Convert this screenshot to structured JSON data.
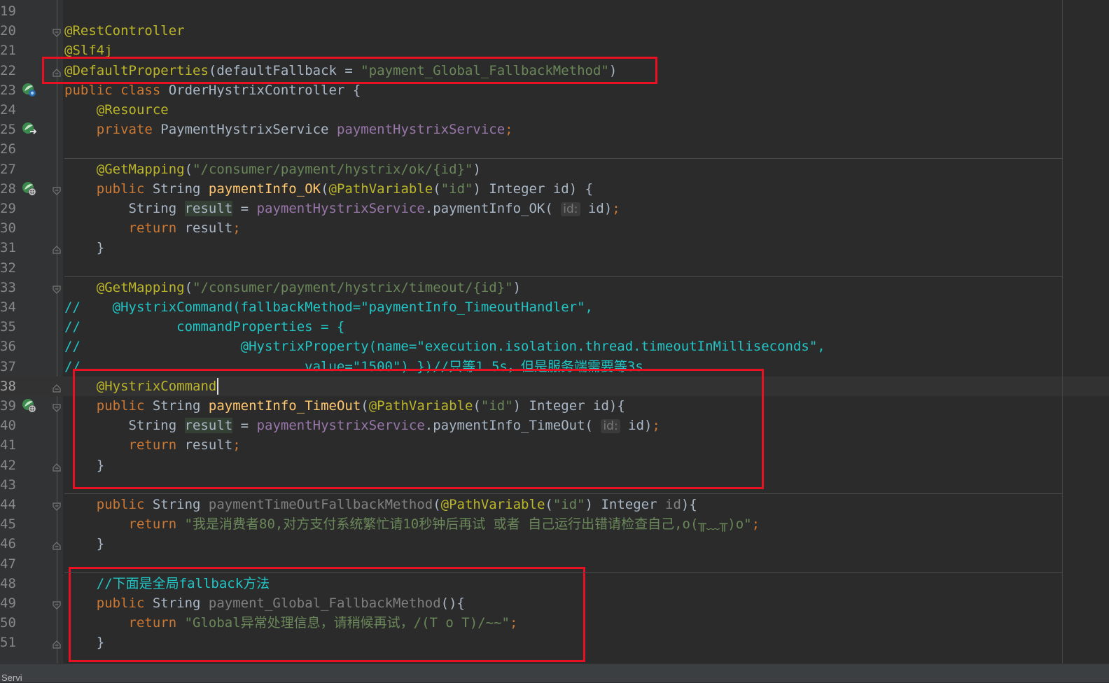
{
  "editor": {
    "language": "java",
    "current_line": 38,
    "lines": [
      {
        "n": "19",
        "segs": []
      },
      {
        "n": "20",
        "segs": [
          [
            "ann",
            "@RestController"
          ]
        ],
        "fold": "open"
      },
      {
        "n": "21",
        "segs": [
          [
            "ann",
            "@Slf4j"
          ]
        ]
      },
      {
        "n": "22",
        "segs": [
          [
            "ann",
            "@DefaultProperties"
          ],
          [
            "",
            "("
          ],
          [
            "",
            "defaultFallback = "
          ],
          [
            "str",
            "\"payment_Global_FallbackMethod\""
          ],
          [
            "",
            ")"
          ]
        ],
        "fold": "close"
      },
      {
        "n": "23",
        "segs": [
          [
            "kw",
            "public class "
          ],
          [
            "",
            "OrderHystrixController {"
          ]
        ],
        "marker": "bean-class"
      },
      {
        "n": "24",
        "segs": [
          [
            "",
            "    "
          ],
          [
            "ann",
            "@Resource"
          ]
        ]
      },
      {
        "n": "25",
        "segs": [
          [
            "",
            "    "
          ],
          [
            "kw",
            "private "
          ],
          [
            "",
            "PaymentHystrixService "
          ],
          [
            "fld",
            "paymentHystrixService"
          ],
          [
            "kw",
            ";"
          ]
        ],
        "marker": "bean-inject"
      },
      {
        "n": "26",
        "segs": []
      },
      {
        "n": "27",
        "segs": [
          [
            "",
            "    "
          ],
          [
            "ann",
            "@GetMapping"
          ],
          [
            "",
            "("
          ],
          [
            "str",
            "\"/consumer/payment/hystrix/ok/{id}\""
          ],
          [
            "",
            ")"
          ]
        ]
      },
      {
        "n": "28",
        "segs": [
          [
            "",
            "    "
          ],
          [
            "kw",
            "public "
          ],
          [
            "",
            "String "
          ],
          [
            "fn",
            "paymentInfo_OK"
          ],
          [
            "",
            "("
          ],
          [
            "ann",
            "@PathVariable"
          ],
          [
            "",
            "("
          ],
          [
            "str",
            "\"id\""
          ],
          [
            "",
            ") Integer id) {"
          ]
        ],
        "marker": "web",
        "fold": "open"
      },
      {
        "n": "29",
        "segs": [
          [
            "",
            "        String "
          ],
          [
            "hl",
            "result"
          ],
          [
            "",
            " = "
          ],
          [
            "fld",
            "paymentHystrixService"
          ],
          [
            "",
            ".paymentInfo_OK( "
          ],
          [
            "hint",
            "id:"
          ],
          [
            "",
            " id)"
          ],
          [
            "kw",
            ";"
          ]
        ]
      },
      {
        "n": "30",
        "segs": [
          [
            "",
            "        "
          ],
          [
            "kw",
            "return "
          ],
          [
            "",
            "result"
          ],
          [
            "kw",
            ";"
          ]
        ]
      },
      {
        "n": "31",
        "segs": [
          [
            "",
            "    }"
          ]
        ],
        "fold": "close"
      },
      {
        "n": "32",
        "segs": []
      },
      {
        "n": "33",
        "segs": [
          [
            "",
            "    "
          ],
          [
            "ann",
            "@GetMapping"
          ],
          [
            "",
            "("
          ],
          [
            "str",
            "\"/consumer/payment/hystrix/timeout/{id}\""
          ],
          [
            "",
            ")"
          ]
        ],
        "fold": "open"
      },
      {
        "n": "34",
        "segs": [
          [
            "cmtg",
            "//    @HystrixCommand(fallbackMethod=\"paymentInfo_TimeoutHandler\","
          ]
        ]
      },
      {
        "n": "35",
        "segs": [
          [
            "cmtg",
            "//            commandProperties = {"
          ]
        ]
      },
      {
        "n": "36",
        "segs": [
          [
            "cmtg",
            "//                    @HystrixProperty(name=\"execution.isolation.thread.timeoutInMilliseconds\","
          ]
        ]
      },
      {
        "n": "37",
        "segs": [
          [
            "cmtg",
            "//                            value=\"1500\") })//只等1.5s，但是服务端需要等3s"
          ]
        ]
      },
      {
        "n": "38",
        "segs": [
          [
            "",
            "    "
          ],
          [
            "ann",
            "@HystrixCommand"
          ]
        ],
        "fold": "close"
      },
      {
        "n": "39",
        "segs": [
          [
            "",
            "    "
          ],
          [
            "kw",
            "public "
          ],
          [
            "",
            "String "
          ],
          [
            "fn",
            "paymentInfo_TimeOut"
          ],
          [
            "",
            "("
          ],
          [
            "ann",
            "@PathVariable"
          ],
          [
            "",
            "("
          ],
          [
            "str",
            "\"id\""
          ],
          [
            "",
            ") Integer id){"
          ]
        ],
        "marker": "web",
        "fold": "open"
      },
      {
        "n": "40",
        "segs": [
          [
            "",
            "        String "
          ],
          [
            "hl",
            "result"
          ],
          [
            "",
            " = "
          ],
          [
            "fld",
            "paymentHystrixService"
          ],
          [
            "",
            ".paymentInfo_TimeOut( "
          ],
          [
            "hint",
            "id:"
          ],
          [
            "",
            " id)"
          ],
          [
            "kw",
            ";"
          ]
        ]
      },
      {
        "n": "41",
        "segs": [
          [
            "",
            "        "
          ],
          [
            "kw",
            "return "
          ],
          [
            "",
            "result"
          ],
          [
            "kw",
            ";"
          ]
        ]
      },
      {
        "n": "42",
        "segs": [
          [
            "",
            "    }"
          ]
        ],
        "fold": "close"
      },
      {
        "n": "43",
        "segs": []
      },
      {
        "n": "44",
        "segs": [
          [
            "",
            "    "
          ],
          [
            "kw",
            "public "
          ],
          [
            "",
            "String "
          ],
          [
            "unused",
            "paymentTimeOutFallbackMethod"
          ],
          [
            "",
            "("
          ],
          [
            "ann",
            "@PathVariable"
          ],
          [
            "",
            "("
          ],
          [
            "str",
            "\"id\""
          ],
          [
            "",
            ") Integer "
          ],
          [
            "unused",
            "id"
          ],
          [
            "",
            "){"
          ]
        ],
        "fold": "open"
      },
      {
        "n": "45",
        "segs": [
          [
            "",
            "        "
          ],
          [
            "kw",
            "return "
          ],
          [
            "str",
            "\"我是消费者80,对方支付系统繁忙请10秒钟后再试 或者 自己运行出错请检查自己,o(╥﹏╥)o\""
          ],
          [
            "kw",
            ";"
          ]
        ]
      },
      {
        "n": "46",
        "segs": [
          [
            "",
            "    }"
          ]
        ],
        "fold": "close"
      },
      {
        "n": "47",
        "segs": []
      },
      {
        "n": "48",
        "segs": [
          [
            "",
            "    "
          ],
          [
            "cmtg",
            "//下面是全局fallback方法"
          ]
        ]
      },
      {
        "n": "49",
        "segs": [
          [
            "",
            "    "
          ],
          [
            "kw",
            "public "
          ],
          [
            "",
            "String "
          ],
          [
            "unused",
            "payment_Global_FallbackMethod"
          ],
          [
            "",
            "(){"
          ]
        ],
        "fold": "open"
      },
      {
        "n": "50",
        "segs": [
          [
            "",
            "        "
          ],
          [
            "kw",
            "return "
          ],
          [
            "str",
            "\"Global异常处理信息，请稍候再试，/(T o T)/~~\""
          ],
          [
            "kw",
            ";"
          ]
        ]
      },
      {
        "n": "51",
        "segs": [
          [
            "",
            "    }"
          ]
        ],
        "fold": "close"
      }
    ]
  },
  "statusbar": {
    "text": "Servi"
  },
  "colors": {
    "background": "#2b2b2b",
    "annotation": "#bbb529",
    "keyword": "#cc7832",
    "string": "#6a8759",
    "field": "#9876aa",
    "method": "#ffc66d",
    "comment": "#21c5c5",
    "highlight_box": "#e81123"
  }
}
